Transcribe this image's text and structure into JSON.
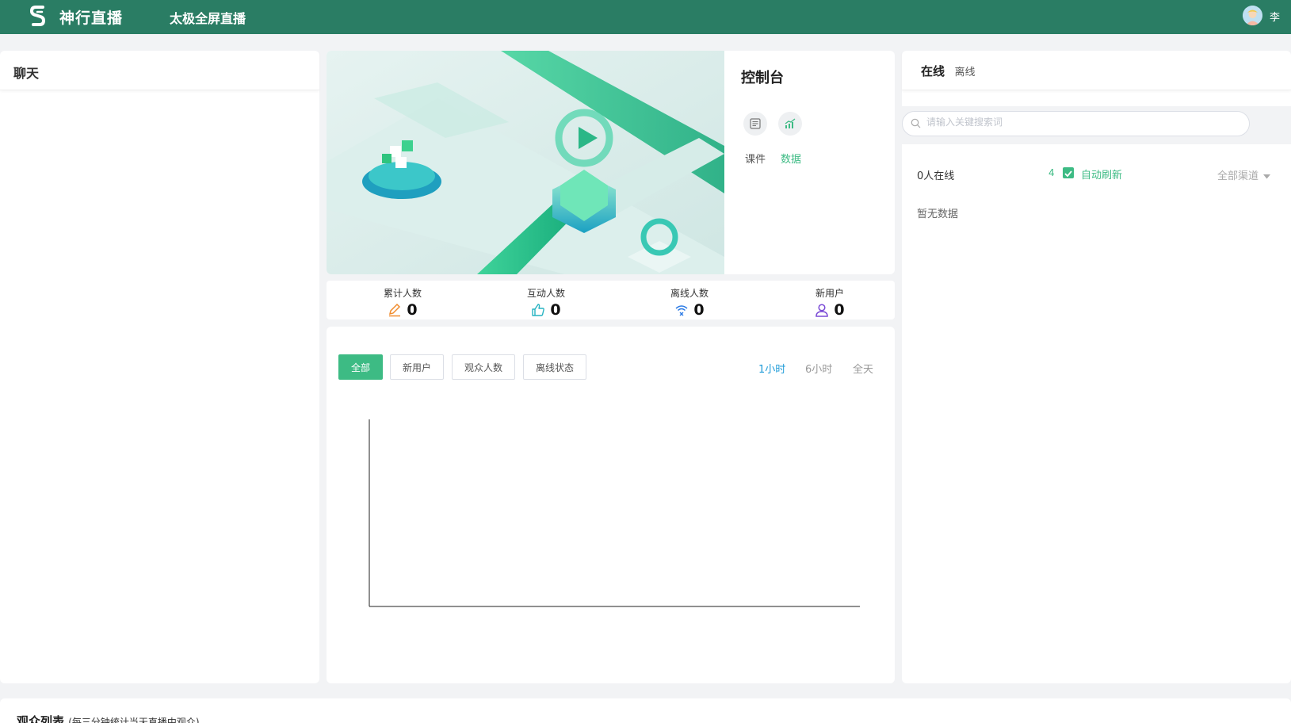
{
  "header": {
    "brand": "神行直播",
    "title": "太极全屏直播",
    "user_name": "李"
  },
  "chat": {
    "title": "聊天"
  },
  "console": {
    "title": "控制台",
    "courseware_label": "课件",
    "data_label": "数据"
  },
  "stats": [
    {
      "label": "累计人数",
      "value": "0",
      "icon": "pencil-icon",
      "color": "#f08c2e"
    },
    {
      "label": "互动人数",
      "value": "0",
      "icon": "thumbs-up-icon",
      "color": "#27b3c2"
    },
    {
      "label": "离线人数",
      "value": "0",
      "icon": "wifi-off-icon",
      "color": "#2c7be5"
    },
    {
      "label": "新用户",
      "value": "0",
      "icon": "user-icon",
      "color": "#7b4bd6"
    }
  ],
  "chart": {
    "filters": [
      "全部",
      "新用户",
      "观众人数",
      "离线状态"
    ],
    "active_filter": "全部",
    "ranges": [
      "1小时",
      "6小时",
      "全天"
    ],
    "active_range": "1小时"
  },
  "chart_data": {
    "type": "line",
    "title": "",
    "xlabel": "",
    "ylabel": "",
    "series": []
  },
  "online": {
    "tab_online": "在线",
    "tab_offline": "离线",
    "search_placeholder": "请输入关键搜索词",
    "online_count": "0人在线",
    "refresh_interval": "4",
    "auto_refresh_label": "自动刷新",
    "channel_select": "全部渠道",
    "empty_text": "暂无数据"
  },
  "audience": {
    "title": "观众列表",
    "subtitle": "(每三分钟统计当天直播中观众)"
  },
  "colors": {
    "header_bg": "#2a7d64",
    "accent": "#3dbb84",
    "range_active": "#1e9bd8"
  }
}
